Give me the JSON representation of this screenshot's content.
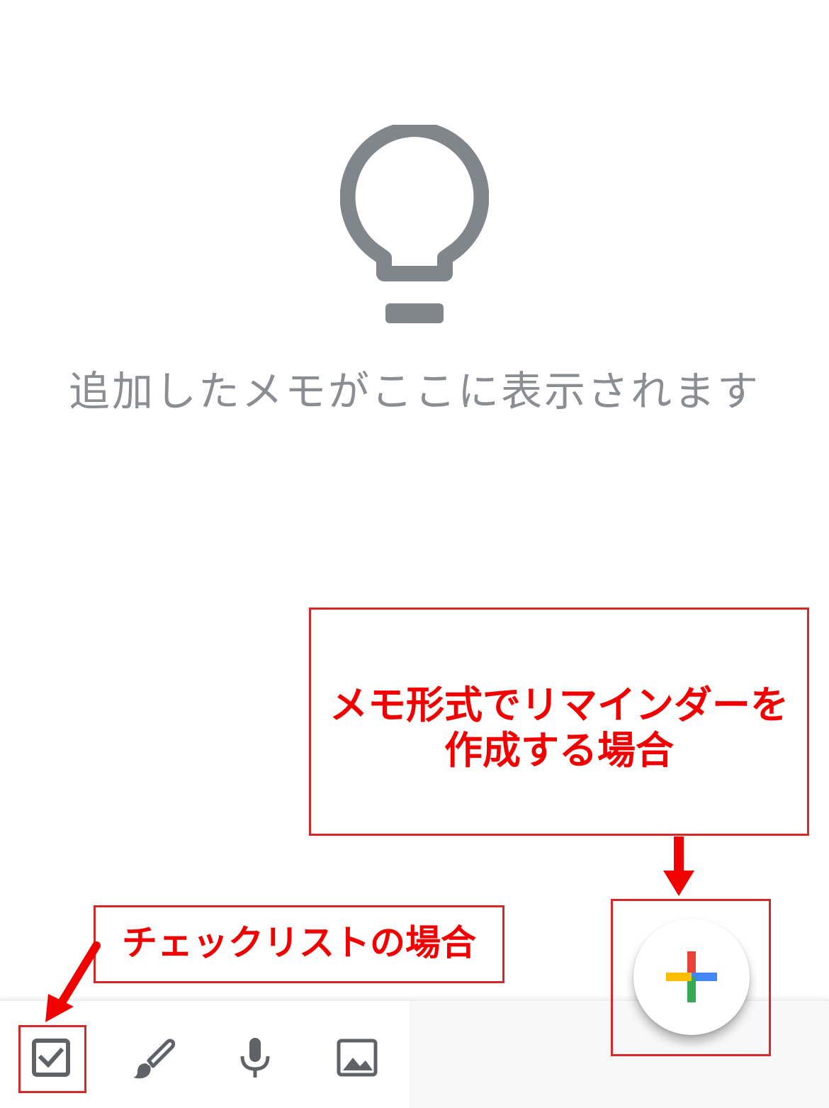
{
  "empty_state": {
    "icon": "lightbulb-icon",
    "message": "追加したメモがここに表示されます"
  },
  "bottom_bar": {
    "items": [
      {
        "icon": "checkbox-icon"
      },
      {
        "icon": "brush-icon"
      },
      {
        "icon": "microphone-icon"
      },
      {
        "icon": "image-icon"
      }
    ]
  },
  "fab": {
    "icon": "plus-icon",
    "colors": {
      "red": "#EA4335",
      "blue": "#4285F4",
      "green": "#34A853",
      "yellow": "#FBBC04"
    }
  },
  "annotations": {
    "memo_line1": "メモ形式でリマインダーを",
    "memo_line2": "作成する場合",
    "checklist": "チェックリストの場合",
    "color": "#F20000"
  },
  "colors": {
    "icon_gray": "#80868B",
    "text_gray": "#8A8D91"
  }
}
